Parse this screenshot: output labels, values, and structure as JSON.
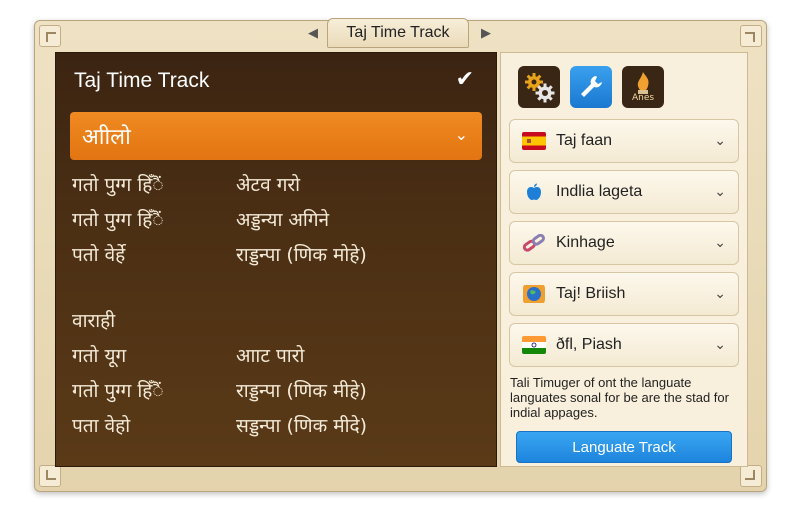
{
  "window": {
    "title": "Taj Time Track",
    "nav_prev": "◀",
    "nav_next": "▶"
  },
  "left_panel": {
    "title": "Taj Time Track",
    "check": "✔",
    "dropdown": {
      "value": "आीलो",
      "chevron": "⌄"
    },
    "rows_group1": [
      {
        "col1": "गतो पुग्ग हिँैं",
        "col2": "अेटव गरो"
      },
      {
        "col1": "गतो पुग्ग हिँैं",
        "col2": "अड्डन्या अगिने"
      },
      {
        "col1": "पतो वेर्हे",
        "col2": "राड्डन्पा (णिक मोहे)"
      }
    ],
    "section_label": "वाराही",
    "rows_group2": [
      {
        "col1": "गतो यूग",
        "col2": "आाट पारो"
      },
      {
        "col1": "गतो पुग्ग हिँैं",
        "col2": "राड्डन्पा (णिक मीहे)"
      },
      {
        "col1": "पता वेहो",
        "col2": "सड्डन्पा (णिक मीदे)"
      }
    ]
  },
  "right_panel": {
    "toolbar": {
      "area_label": "Anes"
    },
    "languages": [
      {
        "name": "Taj faan",
        "flag": "spain"
      },
      {
        "name": "Indlia lageta",
        "flag": "apple"
      },
      {
        "name": "Kinhage",
        "flag": "link"
      },
      {
        "name": "Taj! Briish",
        "flag": "globe"
      },
      {
        "name": "ðfl, Piash",
        "flag": "india"
      }
    ],
    "description": "Tali Timuger of ont the languate languates sonal for be are the stad for indial appages.",
    "action_button": "Languate Track"
  }
}
